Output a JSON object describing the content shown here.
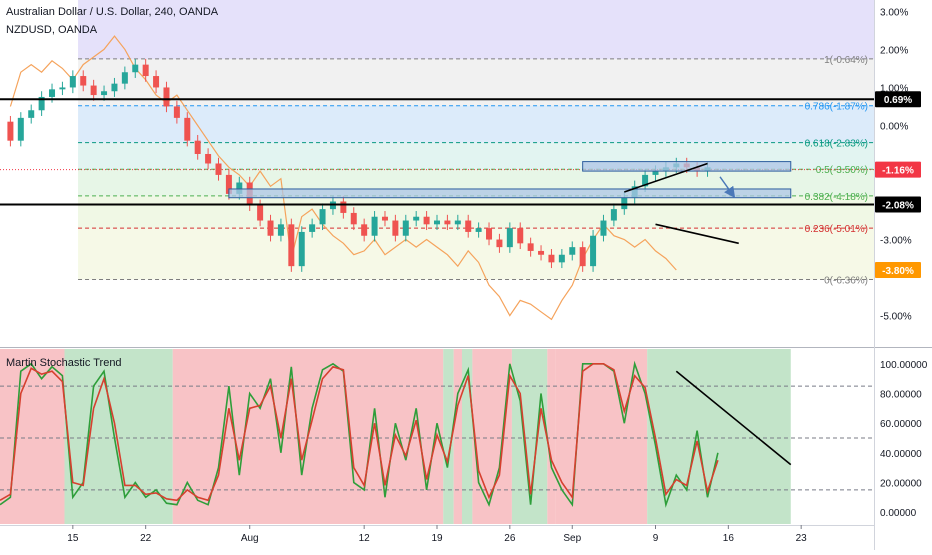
{
  "header": {
    "title": "Australian Dollar / U.S. Dollar, 240, OANDA",
    "compare_symbol": "NZDUSD, OANDA"
  },
  "indicator": {
    "name": "Martin Stochastic Trend"
  },
  "colors": {
    "candle_up": "#26a69a",
    "candle_down": "#ef5350",
    "compare_line": "#f5a35c",
    "stoch_k": "#2e9e3a",
    "stoch_d": "#d6402f",
    "zone_green": "#b9dfc0",
    "zone_red": "#f7b8bc",
    "box_fill": "#aec6e6",
    "box_stroke": "#2e5e9e",
    "label_black": "#000000",
    "label_red": "#f23645",
    "label_orange": "#ff9800",
    "fib_100": "#7e7e7e",
    "fib_786": "#2196f3",
    "fib_618": "#089981",
    "fib_50": "#4caf50",
    "fib_382": "#4caf50",
    "fib_236": "#d32f2f",
    "fib_0": "#7e7e7e"
  },
  "chart_data": [
    {
      "type": "line",
      "name": "price-pane",
      "x_axis": {
        "tick_labels": [
          "15",
          "22",
          "Aug",
          "12",
          "19",
          "26",
          "Sep",
          "9",
          "16",
          "23"
        ],
        "tick_days": [
          15,
          22,
          32,
          43,
          50,
          57,
          63,
          71,
          78,
          85
        ]
      },
      "y_axis": {
        "unit": "percent",
        "ylim": [
          -5.8,
          3.3
        ],
        "tick_values": [
          3,
          2,
          1,
          0,
          -3,
          -5
        ],
        "tick_labels": [
          "3.00%",
          "2.00%",
          "1.00%",
          "0.00%",
          "-3.00%",
          "-5.00%"
        ]
      },
      "fibonacci": [
        {
          "label": "1(-0.64%)",
          "value": 1.75,
          "color_key": "fib_100"
        },
        {
          "label": "0.786(-1.87%)",
          "value": 0.52,
          "color_key": "fib_786"
        },
        {
          "label": "0.618(-2.83%)",
          "value": -0.45,
          "color_key": "fib_618"
        },
        {
          "label": "0.5(-3.50%)",
          "value": -1.15,
          "color_key": "fib_50"
        },
        {
          "label": "0.382(-4.18%)",
          "value": -1.85,
          "color_key": "fib_382"
        },
        {
          "label": "0.236(-5.01%)",
          "value": -2.7,
          "color_key": "fib_236"
        },
        {
          "label": "0(-6.36%)",
          "value": -4.05,
          "color_key": "fib_0"
        }
      ],
      "horizontal_lines": [
        {
          "value": 0.69,
          "label": "0.69%",
          "color_key": "label_black"
        },
        {
          "value": -2.08,
          "label": "-2.08%",
          "color_key": "label_black"
        }
      ],
      "price_labels": [
        {
          "value": -1.16,
          "label": "-1.16%",
          "color_key": "label_red"
        },
        {
          "value": -3.8,
          "label": "-3.80%",
          "color_key": "label_orange"
        }
      ],
      "zones": [
        {
          "start_day": 64,
          "end_day": 84,
          "low": -1.2,
          "high": -0.95
        },
        {
          "start_day": 30,
          "end_day": 84,
          "low": -1.9,
          "high": -1.67
        }
      ],
      "trendlines": [
        {
          "from": [
            68,
            -1.75
          ],
          "to": [
            76,
            -1.0
          ]
        },
        {
          "from": [
            71,
            -2.6
          ],
          "to": [
            79,
            -3.1
          ]
        }
      ],
      "arrow": {
        "from": [
          77.2,
          -1.35
        ],
        "to": [
          78.5,
          -1.85
        ]
      },
      "main_series": [
        [
          8,
          0.1
        ],
        [
          9,
          -0.4
        ],
        [
          10,
          0.2
        ],
        [
          11,
          0.4
        ],
        [
          12,
          0.75
        ],
        [
          13,
          0.95
        ],
        [
          14,
          1.0
        ],
        [
          15,
          1.3
        ],
        [
          16,
          1.05
        ],
        [
          17,
          0.8
        ],
        [
          18,
          0.9
        ],
        [
          19,
          1.1
        ],
        [
          20,
          1.4
        ],
        [
          21,
          1.6
        ],
        [
          22,
          1.3
        ],
        [
          23,
          1.0
        ],
        [
          24,
          0.5
        ],
        [
          25,
          0.2
        ],
        [
          26,
          -0.4
        ],
        [
          27,
          -0.75
        ],
        [
          28,
          -1.0
        ],
        [
          29,
          -1.3
        ],
        [
          30,
          -1.8
        ],
        [
          31,
          -1.5
        ],
        [
          32,
          -2.1
        ],
        [
          33,
          -2.5
        ],
        [
          34,
          -2.9
        ],
        [
          35,
          -2.6
        ],
        [
          36,
          -3.7
        ],
        [
          37,
          -2.8
        ],
        [
          38,
          -2.6
        ],
        [
          39,
          -2.2
        ],
        [
          40,
          -2.0
        ],
        [
          41,
          -2.3
        ],
        [
          42,
          -2.6
        ],
        [
          43,
          -2.9
        ],
        [
          44,
          -2.4
        ],
        [
          45,
          -2.5
        ],
        [
          46,
          -2.9
        ],
        [
          47,
          -2.5
        ],
        [
          48,
          -2.4
        ],
        [
          49,
          -2.6
        ],
        [
          50,
          -2.5
        ],
        [
          51,
          -2.6
        ],
        [
          52,
          -2.5
        ],
        [
          53,
          -2.8
        ],
        [
          54,
          -2.7
        ],
        [
          55,
          -3.0
        ],
        [
          56,
          -3.2
        ],
        [
          57,
          -2.7
        ],
        [
          58,
          -3.1
        ],
        [
          59,
          -3.3
        ],
        [
          60,
          -3.4
        ],
        [
          61,
          -3.6
        ],
        [
          62,
          -3.4
        ],
        [
          63,
          -3.2
        ],
        [
          64,
          -3.7
        ],
        [
          65,
          -2.9
        ],
        [
          66,
          -2.5
        ],
        [
          67,
          -2.2
        ],
        [
          68,
          -1.9
        ],
        [
          69,
          -1.6
        ],
        [
          70,
          -1.3
        ],
        [
          71,
          -1.2
        ],
        [
          72,
          -1.1
        ],
        [
          73,
          -1.0
        ],
        [
          74,
          -1.1
        ],
        [
          75,
          -1.2
        ],
        [
          76,
          -1.1
        ]
      ],
      "compare_series": [
        [
          9,
          0.5
        ],
        [
          10,
          1.4
        ],
        [
          11,
          1.6
        ],
        [
          12,
          1.4
        ],
        [
          13,
          1.7
        ],
        [
          14,
          1.5
        ],
        [
          15,
          1.2
        ],
        [
          16,
          1.6
        ],
        [
          17,
          1.8
        ],
        [
          18,
          2.0
        ],
        [
          19,
          2.35
        ],
        [
          20,
          2.0
        ],
        [
          21,
          1.5
        ],
        [
          22,
          1.2
        ],
        [
          23,
          0.8
        ],
        [
          24,
          0.6
        ],
        [
          25,
          0.8
        ],
        [
          26,
          0.4
        ],
        [
          27,
          0.0
        ],
        [
          28,
          -0.4
        ],
        [
          29,
          -0.8
        ],
        [
          30,
          -1.1
        ],
        [
          31,
          -1.3
        ],
        [
          32,
          -1.6
        ],
        [
          33,
          -1.2
        ],
        [
          34,
          -1.6
        ],
        [
          35,
          -1.4
        ],
        [
          36,
          -3.5
        ],
        [
          37,
          -2.4
        ],
        [
          38,
          -2.2
        ],
        [
          39,
          -2.6
        ],
        [
          40,
          -2.9
        ],
        [
          41,
          -3.1
        ],
        [
          42,
          -3.4
        ],
        [
          43,
          -3.3
        ],
        [
          44,
          -3.0
        ],
        [
          45,
          -3.4
        ],
        [
          46,
          -3.2
        ],
        [
          47,
          -3.0
        ],
        [
          48,
          -3.2
        ],
        [
          49,
          -3.0
        ],
        [
          50,
          -3.2
        ],
        [
          51,
          -3.4
        ],
        [
          52,
          -3.7
        ],
        [
          53,
          -3.3
        ],
        [
          54,
          -3.6
        ],
        [
          55,
          -4.2
        ],
        [
          56,
          -4.5
        ],
        [
          57,
          -5.0
        ],
        [
          58,
          -4.6
        ],
        [
          59,
          -4.7
        ],
        [
          60,
          -4.9
        ],
        [
          61,
          -5.1
        ],
        [
          62,
          -4.6
        ],
        [
          63,
          -4.2
        ],
        [
          64,
          -3.5
        ],
        [
          65,
          -3.0
        ],
        [
          66,
          -2.6
        ],
        [
          67,
          -2.9
        ],
        [
          68,
          -3.0
        ],
        [
          69,
          -3.2
        ],
        [
          70,
          -3.0
        ],
        [
          71,
          -3.3
        ],
        [
          72,
          -3.5
        ],
        [
          73,
          -3.8
        ]
      ]
    },
    {
      "type": "line",
      "name": "indicator-pane",
      "title": "Martin Stochastic Trend",
      "y_axis": {
        "ylim": [
          -8,
          110
        ],
        "tick_values": [
          100,
          80,
          60,
          40,
          20,
          0
        ],
        "tick_labels": [
          "100.00000",
          "80.00000",
          "60.00000",
          "40.00000",
          "20.00000",
          "0.00000"
        ]
      },
      "dashed_levels": [
        85,
        50,
        15
      ],
      "zones": [
        {
          "start_day": 8,
          "end_day": 14.2,
          "state": "red"
        },
        {
          "start_day": 14.2,
          "end_day": 24.6,
          "state": "green"
        },
        {
          "start_day": 24.6,
          "end_day": 50.6,
          "state": "red"
        },
        {
          "start_day": 50.6,
          "end_day": 51.6,
          "state": "green"
        },
        {
          "start_day": 51.6,
          "end_day": 52.4,
          "state": "red"
        },
        {
          "start_day": 52.4,
          "end_day": 53.4,
          "state": "green"
        },
        {
          "start_day": 53.4,
          "end_day": 57.2,
          "state": "red"
        },
        {
          "start_day": 57.2,
          "end_day": 60.6,
          "state": "green"
        },
        {
          "start_day": 60.6,
          "end_day": 61.4,
          "state": "red"
        },
        {
          "start_day": 61.4,
          "end_day": 70.2,
          "state": "red"
        },
        {
          "start_day": 70.2,
          "end_day": 84,
          "state": "green"
        }
      ],
      "trendline": {
        "from": [
          73,
          95
        ],
        "to": [
          84,
          32
        ]
      },
      "k_series": [
        [
          8,
          5
        ],
        [
          9,
          10
        ],
        [
          10,
          95
        ],
        [
          11,
          100
        ],
        [
          12,
          90
        ],
        [
          13,
          98
        ],
        [
          14,
          92
        ],
        [
          15,
          10
        ],
        [
          16,
          20
        ],
        [
          17,
          85
        ],
        [
          18,
          95
        ],
        [
          19,
          50
        ],
        [
          20,
          10
        ],
        [
          21,
          20
        ],
        [
          22,
          10
        ],
        [
          23,
          15
        ],
        [
          24,
          6
        ],
        [
          25,
          5
        ],
        [
          26,
          20
        ],
        [
          27,
          8
        ],
        [
          28,
          5
        ],
        [
          29,
          30
        ],
        [
          30,
          85
        ],
        [
          31,
          25
        ],
        [
          32,
          80
        ],
        [
          33,
          70
        ],
        [
          34,
          90
        ],
        [
          35,
          40
        ],
        [
          36,
          98
        ],
        [
          37,
          25
        ],
        [
          38,
          70
        ],
        [
          39,
          96
        ],
        [
          40,
          100
        ],
        [
          41,
          95
        ],
        [
          42,
          20
        ],
        [
          43,
          15
        ],
        [
          44,
          70
        ],
        [
          45,
          10
        ],
        [
          46,
          60
        ],
        [
          47,
          35
        ],
        [
          48,
          70
        ],
        [
          49,
          15
        ],
        [
          50,
          60
        ],
        [
          51,
          30
        ],
        [
          52,
          80
        ],
        [
          53,
          96
        ],
        [
          54,
          20
        ],
        [
          55,
          5
        ],
        [
          56,
          30
        ],
        [
          57,
          100
        ],
        [
          58,
          75
        ],
        [
          59,
          5
        ],
        [
          60,
          80
        ],
        [
          61,
          30
        ],
        [
          62,
          15
        ],
        [
          63,
          5
        ],
        [
          64,
          100
        ],
        [
          65,
          100
        ],
        [
          66,
          100
        ],
        [
          67,
          95
        ],
        [
          68,
          60
        ],
        [
          69,
          100
        ],
        [
          70,
          80
        ],
        [
          71,
          45
        ],
        [
          72,
          5
        ],
        [
          73,
          25
        ],
        [
          74,
          15
        ],
        [
          75,
          55
        ],
        [
          76,
          10
        ],
        [
          77,
          40
        ]
      ],
      "d_series": [
        [
          8,
          8
        ],
        [
          9,
          12
        ],
        [
          10,
          80
        ],
        [
          11,
          97
        ],
        [
          12,
          93
        ],
        [
          13,
          95
        ],
        [
          14,
          88
        ],
        [
          15,
          20
        ],
        [
          16,
          18
        ],
        [
          17,
          70
        ],
        [
          18,
          90
        ],
        [
          19,
          60
        ],
        [
          20,
          18
        ],
        [
          21,
          18
        ],
        [
          22,
          12
        ],
        [
          23,
          13
        ],
        [
          24,
          9
        ],
        [
          25,
          8
        ],
        [
          26,
          15
        ],
        [
          27,
          10
        ],
        [
          28,
          8
        ],
        [
          29,
          25
        ],
        [
          30,
          70
        ],
        [
          31,
          35
        ],
        [
          32,
          70
        ],
        [
          33,
          72
        ],
        [
          34,
          85
        ],
        [
          35,
          50
        ],
        [
          36,
          90
        ],
        [
          37,
          35
        ],
        [
          38,
          62
        ],
        [
          39,
          90
        ],
        [
          40,
          98
        ],
        [
          41,
          96
        ],
        [
          42,
          30
        ],
        [
          43,
          18
        ],
        [
          44,
          60
        ],
        [
          45,
          18
        ],
        [
          46,
          52
        ],
        [
          47,
          38
        ],
        [
          48,
          62
        ],
        [
          49,
          22
        ],
        [
          50,
          52
        ],
        [
          51,
          34
        ],
        [
          52,
          72
        ],
        [
          53,
          92
        ],
        [
          54,
          28
        ],
        [
          55,
          10
        ],
        [
          56,
          25
        ],
        [
          57,
          92
        ],
        [
          58,
          80
        ],
        [
          59,
          12
        ],
        [
          60,
          70
        ],
        [
          61,
          35
        ],
        [
          62,
          20
        ],
        [
          63,
          10
        ],
        [
          64,
          95
        ],
        [
          65,
          100
        ],
        [
          66,
          100
        ],
        [
          67,
          96
        ],
        [
          68,
          68
        ],
        [
          69,
          92
        ],
        [
          70,
          84
        ],
        [
          71,
          50
        ],
        [
          72,
          12
        ],
        [
          73,
          22
        ],
        [
          74,
          18
        ],
        [
          75,
          48
        ],
        [
          76,
          14
        ],
        [
          77,
          35
        ]
      ]
    }
  ]
}
